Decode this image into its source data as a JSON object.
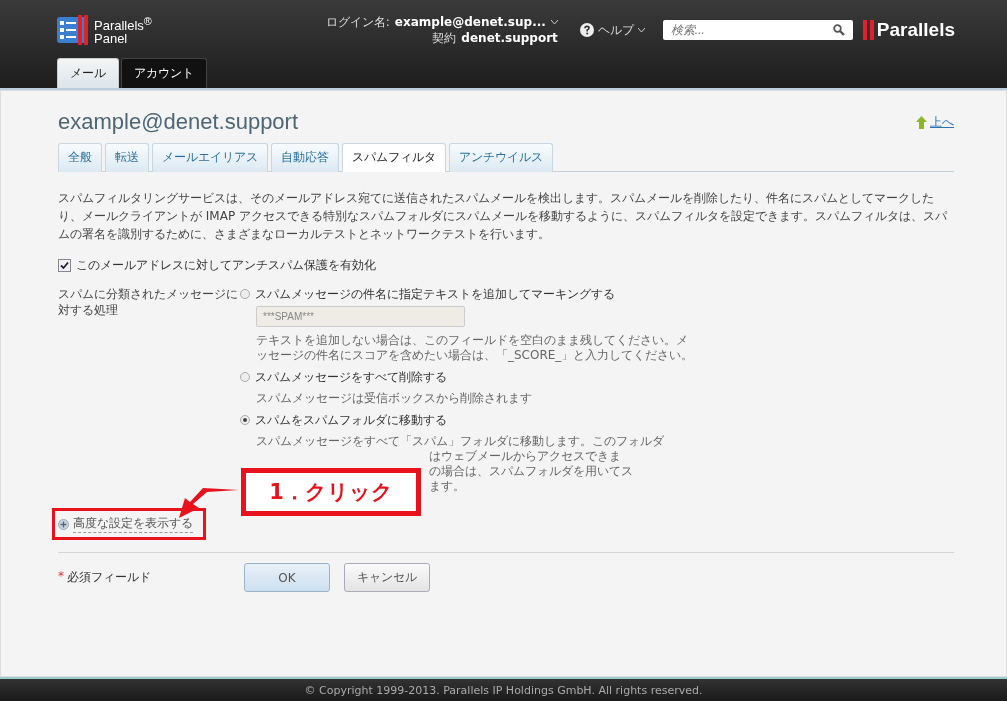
{
  "header": {
    "logo": {
      "line1": "Parallels$^{®}$",
      "line2": "Panel"
    },
    "login": {
      "label": "ログイン名:",
      "value": "example@denet.sup..."
    },
    "contract": {
      "label": "契約",
      "value": "denet.support"
    },
    "help": "ヘルプ",
    "search": {
      "placeholder": "検索..."
    },
    "brand": "Parallels"
  },
  "main_tabs": [
    {
      "label": "メール",
      "selected": true
    },
    {
      "label": "アカウント",
      "selected": false
    }
  ],
  "title": "example@denet.support",
  "up_link": "上へ",
  "tabs": [
    {
      "label": "全般",
      "selected": false
    },
    {
      "label": "転送",
      "selected": false
    },
    {
      "label": "メールエイリアス",
      "selected": false
    },
    {
      "label": "自動応答",
      "selected": false
    },
    {
      "label": "スパムフィルタ",
      "selected": true
    },
    {
      "label": "アンチウイルス",
      "selected": false
    }
  ],
  "description": "スパムフィルタリングサービスは、そのメールアドレス宛てに送信されたスパムメールを検出します。スパムメールを削除したり、件名にスパムとしてマークしたり、メールクライアントが IMAP アクセスできる特別なスパムフォルダにスパムメールを移動するように、スパムフィルタを設定できます。スパムフィルタは、スパムの署名を識別するために、さまざまなローカルテストとネットワークテストを行います。",
  "antispam": {
    "label": "このメールアドレスに対してアンチスパム保護を有効化",
    "checked": true
  },
  "action_label": "スパムに分類されたメッセージに対する処理",
  "options": [
    {
      "label": "スパムメッセージの件名に指定テキストを追加してマーキングする",
      "selected": false,
      "field": {
        "value": "***SPAM***",
        "disabled": true
      },
      "hints": [
        {
          "text": "テキストを追加しない場合は、このフィールドを空白のまま残してください。メッセージの件名にスコアを含めたい場合は、「_SCORE_」と入力してください。",
          "partly_covered": false
        }
      ]
    },
    {
      "label": "スパムメッセージをすべて削除する",
      "selected": false,
      "hints": [
        {
          "text": "スパムメッセージは受信ボックスから削除されます",
          "partly_covered": false
        }
      ]
    },
    {
      "label": "スパムをスパムフォルダに移動する",
      "selected": true,
      "hints": [
        {
          "text": "スパムメッセージをすべて「スパム」フォルダに移動します。このフォルダ",
          "partly_covered": false
        },
        {
          "text": "はウェブメールからアクセスできま",
          "partly_covered": true
        },
        {
          "text": "の場合は、スパムフォルダを用いてス",
          "partly_covered": true
        },
        {
          "text": "ます。",
          "partly_covered": true
        }
      ]
    }
  ],
  "callout": "1．クリック",
  "advanced_link": "高度な設定を表示する",
  "required": {
    "mark": "*",
    "label": "必須フィールド"
  },
  "buttons": [
    "OK",
    "キャンセル"
  ],
  "footer": "© Copyright 1999-2013. Parallels IP Holdings GmbH. All rights reserved."
}
